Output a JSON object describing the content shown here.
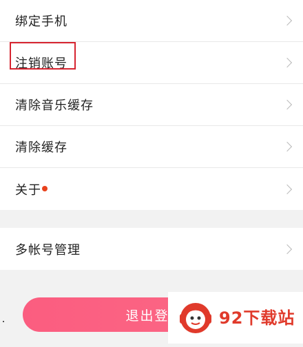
{
  "settings": {
    "group1": [
      {
        "label": "绑定手机"
      },
      {
        "label": "注销账号"
      },
      {
        "label": "清除音乐缓存"
      },
      {
        "label": "清除缓存"
      },
      {
        "label": "关于",
        "badge": true
      }
    ],
    "group2": [
      {
        "label": "多帐号管理"
      }
    ]
  },
  "logout": {
    "label": "退出登"
  },
  "watermark": {
    "text": "92下载站"
  },
  "colors": {
    "highlight": "#d6232f",
    "badge": "#e8421d",
    "logout_button": "#fb5d80",
    "watermark_text": "#e03a2b"
  },
  "icons": {
    "chevron": "chevron-right-icon",
    "watermark_logo": "mascot-logo-icon"
  }
}
